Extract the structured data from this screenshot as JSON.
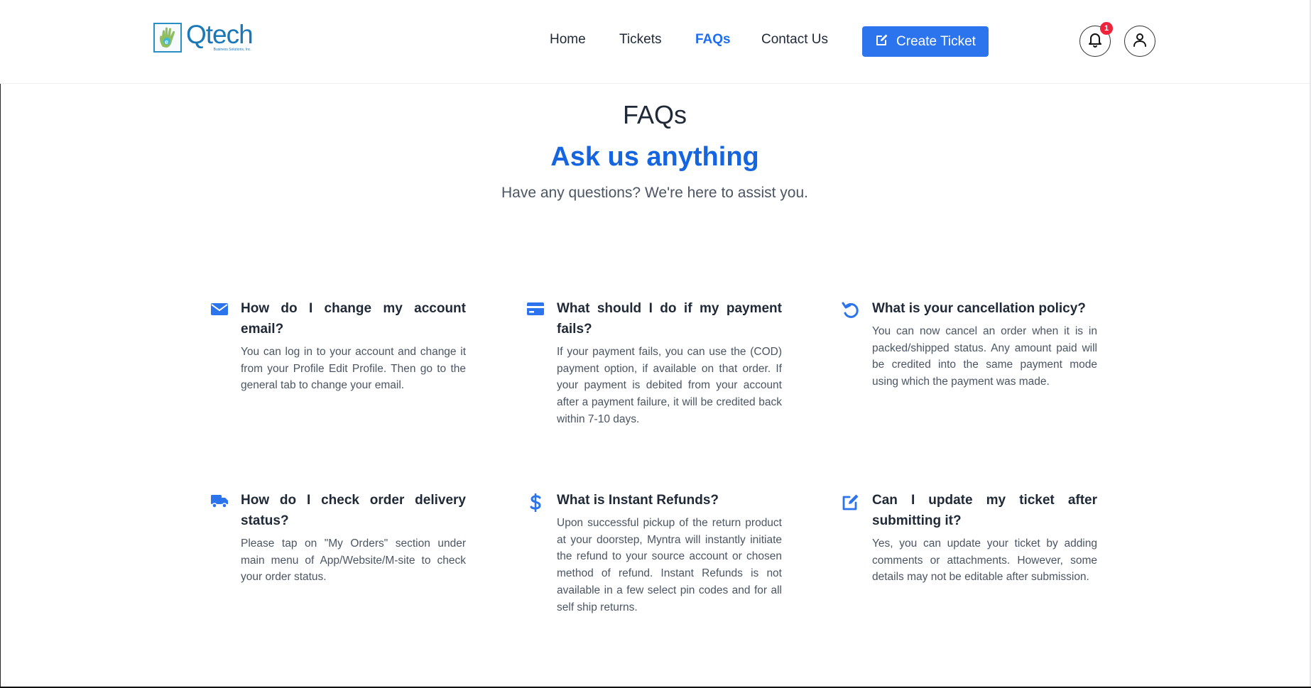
{
  "brand": {
    "name": "Qtech",
    "sub": "Business Solutions, Inc."
  },
  "nav": {
    "home": "Home",
    "tickets": "Tickets",
    "faqs": "FAQs",
    "contact": "Contact Us",
    "create_ticket": "Create Ticket",
    "notification_count": "1",
    "accent_color": "#2c74ee"
  },
  "hero": {
    "title": "FAQs",
    "tagline": "Ask us anything",
    "subtitle": "Have any questions? We're here to assist you."
  },
  "faqs": [
    {
      "icon": "envelope-icon",
      "question": "How do I change my account email?",
      "answer": "You can log in to your account and change it from your Profile Edit Profile. Then go to the general tab to change your email."
    },
    {
      "icon": "credit-card-icon",
      "question": "What should I do if my payment fails?",
      "answer": "If your payment fails, you can use the (COD) payment option, if available on that order. If your payment is debited from your account after a payment failure, it will be credited back within 7-10 days."
    },
    {
      "icon": "undo-icon",
      "question": "What is your cancellation policy?",
      "answer": "You can now cancel an order when it is in packed/shipped status. Any amount paid will be credited into the same payment mode using which the payment was made."
    },
    {
      "icon": "truck-icon",
      "question": "How do I check order delivery status?",
      "answer": "Please tap on \"My Orders\" section under main menu of App/Website/M-site to check your order status."
    },
    {
      "icon": "dollar-icon",
      "question": "What is Instant Refunds?",
      "answer": "Upon successful pickup of the return product at your doorstep, Myntra will instantly initiate the refund to your source account or chosen method of refund. Instant Refunds is not available in a few select pin codes and for all self ship returns."
    },
    {
      "icon": "edit-icon",
      "question": "Can I update my ticket after submitting it?",
      "answer": "Yes, you can update your ticket by adding comments or attachments. However, some details may not be editable after submission."
    }
  ]
}
